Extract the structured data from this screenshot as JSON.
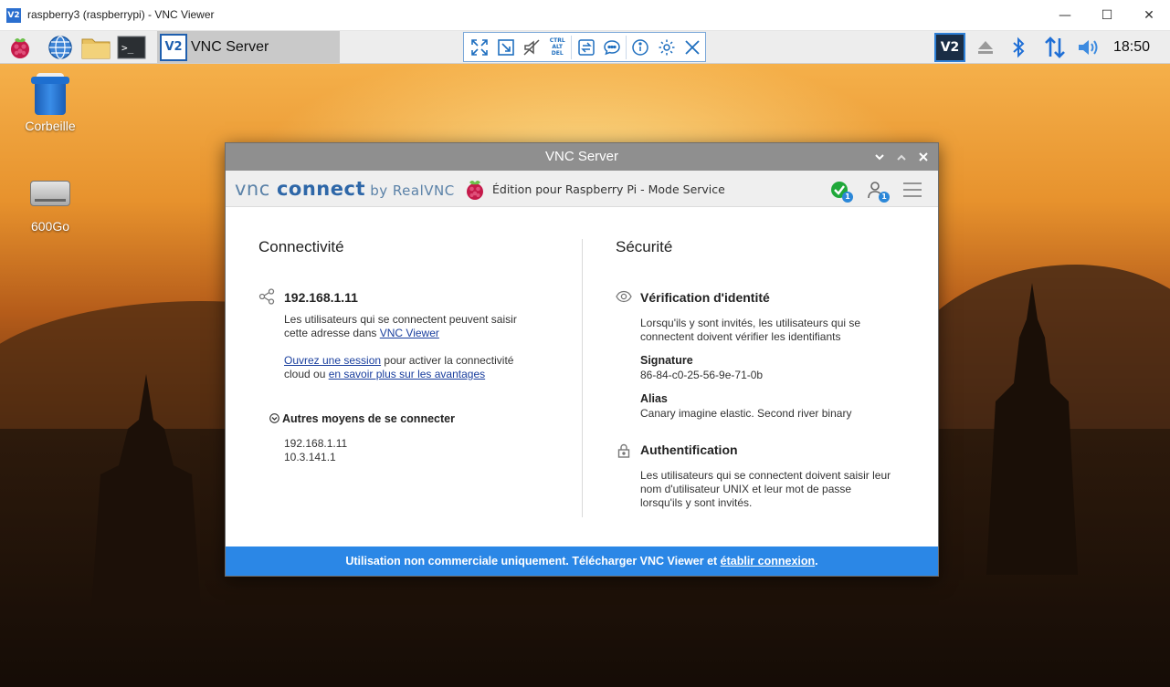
{
  "host_window": {
    "app_icon_text": "V2",
    "title": "raspberry3 (raspberrypi) - VNC Viewer",
    "minimize": "—",
    "maximize": "☐",
    "close": "✕"
  },
  "panel": {
    "task_label": "VNC Server",
    "vnc_mini_icon": "V2",
    "ctrl_alt_del": [
      "CTRL",
      "ALT",
      "DEL"
    ],
    "clock": "18:50",
    "tray_vnc_icon": "V2"
  },
  "desktop": {
    "icons": [
      {
        "label": "Corbeille"
      },
      {
        "label": "600Go"
      }
    ]
  },
  "dialog": {
    "title": "VNC Server",
    "brand": {
      "vnc": "vnc",
      "connect": "connect",
      "by": " by RealVNC"
    },
    "edition": "Édition pour Raspberry Pi - Mode Service",
    "status_badge": "1",
    "user_badge": "1",
    "left": {
      "title": "Connectivité",
      "ip": "192.168.1.11",
      "desc1": "Les utilisateurs qui se connectent peuvent saisir",
      "desc2_prefix": "cette adresse dans ",
      "desc2_link": "VNC Viewer",
      "session_link": "Ouvrez une session",
      "session_suffix": " pour activer la connectivité",
      "cloud_prefix": "cloud ou ",
      "cloud_link": "en savoir plus sur les avantages",
      "other_title": "Autres moyens de se connecter",
      "other_ips": [
        "192.168.1.11",
        "10.3.141.1"
      ]
    },
    "right": {
      "title": "Sécurité",
      "verif_title": "Vérification d'identité",
      "verif_desc1": "Lorsqu'ils y sont invités, les utilisateurs qui se",
      "verif_desc2": "connectent doivent vérifier les identifiants",
      "signature_label": "Signature",
      "signature_value": "86-84-c0-25-56-9e-71-0b",
      "alias_label": "Alias",
      "alias_value": "Canary imagine elastic. Second river binary",
      "auth_title": "Authentification",
      "auth_desc1": "Les utilisateurs qui se connectent doivent saisir leur",
      "auth_desc2": "nom d'utilisateur UNIX et leur mot de passe",
      "auth_desc3": "lorsqu'ils y sont invités."
    },
    "footer": {
      "text": "Utilisation non commerciale uniquement. Télécharger VNC Viewer et ",
      "link": "établir connexion",
      "end": "."
    }
  },
  "colors": {
    "accent": "#2b87e6",
    "dialog_title": "#8f8f8f",
    "status_ok": "#1fa83a"
  }
}
